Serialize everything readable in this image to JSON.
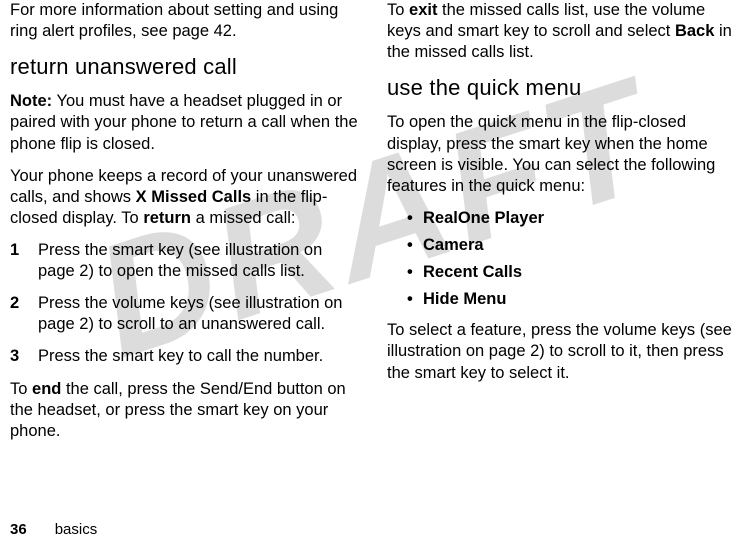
{
  "watermark": "DRAFT",
  "left": {
    "intro": "For more information about setting and using ring alert profiles, see page 42.",
    "h_return": "return unanswered call",
    "note_label": "Note:",
    "note_body": " You must have a headset plugged in or paired with your phone to return a call when the phone flip is closed.",
    "record_a": "Your phone keeps a record of your unanswered calls, and shows ",
    "record_b": "X Missed Calls",
    "record_c": " in the flip-closed display. To ",
    "record_d": "return",
    "record_e": " a missed call:",
    "steps": [
      "Press the smart key (see illustration on page 2) to open the missed calls list.",
      "Press the volume keys (see illustration on page 2) to scroll to an unanswered call.",
      "Press the smart key to call the number."
    ],
    "end_a": "To ",
    "end_b": "end",
    "end_c": " the call, press the Send/End button on the headset, or press the smart key on your phone."
  },
  "right": {
    "exit_a": "To ",
    "exit_b": "exit",
    "exit_c": " the missed calls list, use the volume keys and smart key to scroll and select ",
    "exit_d": "Back",
    "exit_e": " in the missed calls list.",
    "h_quick": "use the quick menu",
    "quick_intro": "To open the quick menu in the flip-closed display, press the smart key when the home screen is visible. You can select the following features in the quick menu:",
    "bullets": [
      "RealOne Player",
      "Camera",
      "Recent Calls",
      "Hide Menu"
    ],
    "select_body": "To select a feature, press the volume keys (see illustration on page 2) to scroll to it, then press the smart key to select it."
  },
  "footer": {
    "page": "36",
    "section": "basics"
  }
}
